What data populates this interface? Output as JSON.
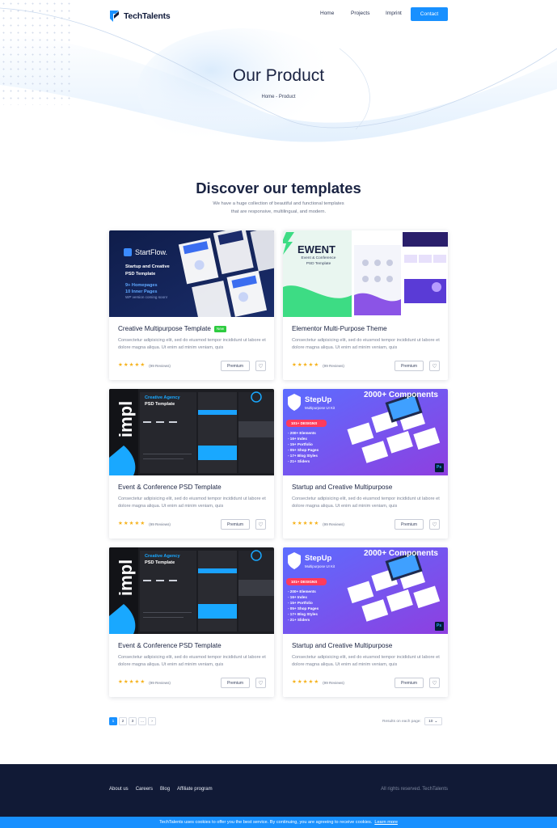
{
  "header": {
    "brand": "TechTalents",
    "nav": [
      "Home",
      "Projects",
      "Imprint"
    ],
    "contact_label": "Contact"
  },
  "hero": {
    "title": "Our Product",
    "breadcrumb": "Home - Product"
  },
  "section": {
    "title": "Discover our templates",
    "subtitle_line1": "We have a huge collection of beautiful and functional templates",
    "subtitle_line2": "that are responsive, multilingual, and modern."
  },
  "cards": [
    {
      "title": "Creative Multipurpose Template",
      "badge": "New",
      "desc": "Consectetur adipisicing elit, sed do eiusmod tempor incididunt ut labore et dolore magna aliqua. Ut enim ad minim veniam, quis",
      "reviews": "(99 Reviews)",
      "rating": 4.5,
      "premium": "Premium",
      "thumb": {
        "brand": "StartFlow.",
        "line1": "Startup and Creative",
        "line2": "PSD Template",
        "line3": "9+ Homepages",
        "line4": "10 Inner Pages",
        "line5": "WP version coming soon!"
      }
    },
    {
      "title": "Elementor Multi-Purpose Theme",
      "badge": "",
      "desc": "Consectetur adipisicing elit, sed do eiusmod tempor incididunt ut labore et dolore magna aliqua. Ut enim ad minim veniam, quis",
      "reviews": "(99 Reviews)",
      "rating": 4.5,
      "premium": "Premium",
      "thumb": {
        "brand": "EWENT",
        "line1": "Event & Conference",
        "line2": "PSD Template"
      }
    },
    {
      "title": "Event & Conference PSD Template",
      "badge": "",
      "desc": "Consectetur adipisicing elit, sed do eiusmod tempor incididunt ut labore et dolore magna aliqua. Ut enim ad minim veniam, quis",
      "reviews": "(99 Reviews)",
      "rating": 4.5,
      "premium": "Premium",
      "thumb": {
        "brand": "impl",
        "line1": "Creative Agency",
        "line2": "PSD Template"
      }
    },
    {
      "title": "Startup and Creative Multipurpose",
      "badge": "",
      "desc": "Consectetur adipisicing elit, sed do eiusmod tempor incididunt ut labore et dolore magna aliqua. Ut enim ad minim veniam, quis",
      "reviews": "(99 Reviews)",
      "rating": 4.5,
      "premium": "Premium",
      "thumb": {
        "brand": "StepUp",
        "sub": "Multipurpose UI Kit",
        "banner": "2000+ Components",
        "ribbon": "101+ DESIGNS",
        "list": [
          "- 200+ Elements",
          "- 16+ Index",
          "- 15+ Portfolio",
          "- 05+ Shop Pages",
          "- 17+ Blog Styles",
          "- 21+ Sliders"
        ],
        "ps": "Ps"
      }
    },
    {
      "title": "Event & Conference PSD Template",
      "badge": "",
      "desc": "Consectetur adipisicing elit, sed do eiusmod tempor incididunt ut labore et dolore magna aliqua. Ut enim ad minim veniam, quis",
      "reviews": "(99 Reviews)",
      "rating": 4.5,
      "premium": "Premium",
      "thumb": {
        "brand": "impl",
        "line1": "Creative Agency",
        "line2": "PSD Template"
      }
    },
    {
      "title": "Startup and Creative Multipurpose",
      "badge": "",
      "desc": "Consectetur adipisicing elit, sed do eiusmod tempor incididunt ut labore et dolore magna aliqua. Ut enim ad minim veniam, quis",
      "reviews": "(99 Reviews)",
      "rating": 4.5,
      "premium": "Premium",
      "thumb": {
        "brand": "StepUp",
        "sub": "Multipurpose UI Kit",
        "banner": "2000+ Components",
        "ribbon": "101+ DESIGNS",
        "list": [
          "- 200+ Elements",
          "- 16+ Index",
          "- 15+ Portfolio",
          "- 05+ Shop Pages",
          "- 17+ Blog Styles",
          "- 21+ Sliders"
        ],
        "ps": "Ps"
      }
    }
  ],
  "pagination": {
    "pages": [
      "1",
      "2",
      "3",
      "...",
      "›"
    ],
    "active": "1",
    "per_page_label": "Results on each page:",
    "per_page_value": "10"
  },
  "footer": {
    "links": [
      "About us",
      "Careers",
      "Blog",
      "Affiliate program"
    ],
    "copyright": "All rights reserved. TechTalents"
  },
  "cookie": {
    "text": "TechTalents uses cookies to offer you the best service. By continuing, you are agreeing to receive cookies.",
    "link": "Learn more"
  },
  "colors": {
    "accent": "#1890ff",
    "footer_bg": "#111a36",
    "star": "#f6b21b",
    "badge_new": "#2ecc40"
  }
}
